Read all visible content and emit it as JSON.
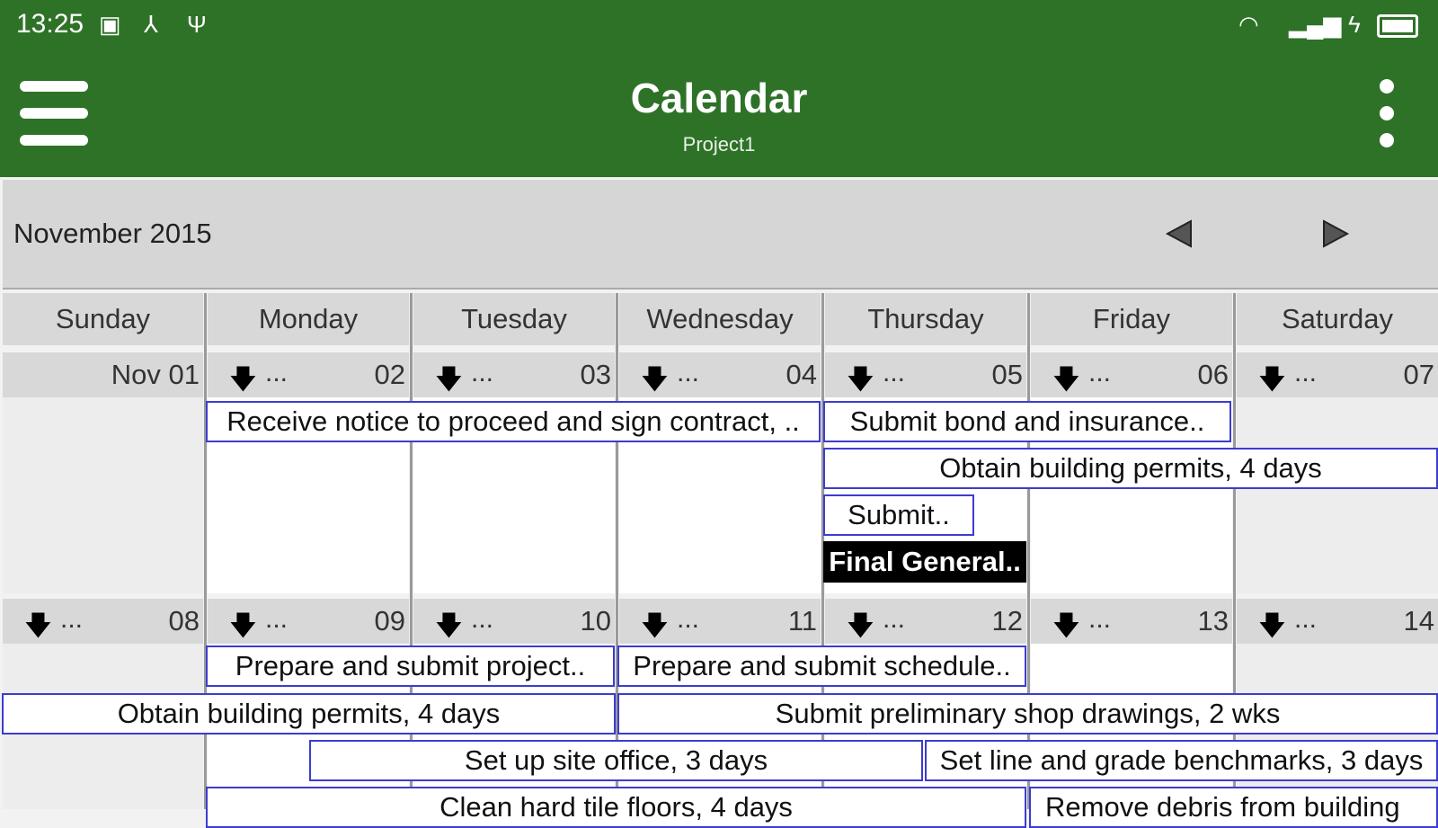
{
  "status": {
    "time": "13:25"
  },
  "app": {
    "title": "Calendar",
    "subtitle": "Project1"
  },
  "month": {
    "label": "November 2015"
  },
  "weekdays": [
    "Sunday",
    "Monday",
    "Tuesday",
    "Wednesday",
    "Thursday",
    "Friday",
    "Saturday"
  ],
  "week1": {
    "dates": [
      "Nov 01",
      "02",
      "03",
      "04",
      "05",
      "06",
      "07"
    ]
  },
  "week2": {
    "dates": [
      "08",
      "09",
      "10",
      "11",
      "12",
      "13",
      "14"
    ]
  },
  "more_indicator": "...",
  "events": {
    "receive_notice": "Receive notice to proceed and sign contract, ..",
    "submit_bond": "Submit bond and insurance..",
    "obtain_permits_w1": "Obtain building permits, 4 days",
    "submit_short": "Submit..",
    "final_general": "Final General..",
    "prepare_project": "Prepare and submit project..",
    "prepare_schedule": "Prepare and submit schedule..",
    "obtain_permits_w2": "Obtain building permits, 4 days",
    "shop_drawings": "Submit preliminary shop drawings, 2 wks",
    "site_office": "Set up site office, 3 days",
    "benchmarks": "Set line and grade benchmarks, 3 days",
    "clean_floors": "Clean hard tile floors, 4 days",
    "remove_debris": "Remove debris from building"
  },
  "colors": {
    "brand": "#2e7228",
    "event_border": "#3c3ccf"
  }
}
